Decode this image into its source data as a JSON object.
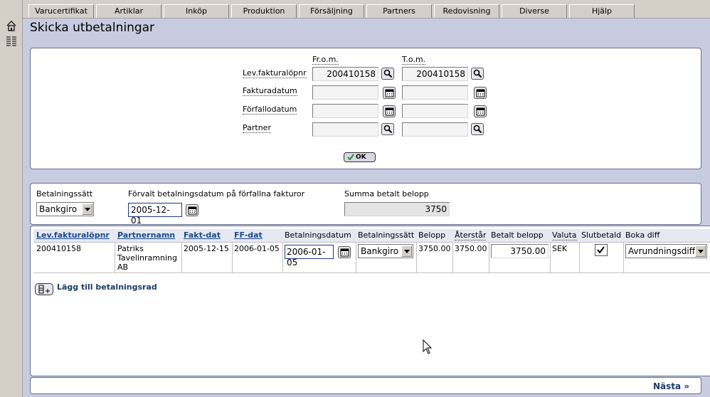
{
  "nav": {
    "tabs": [
      "Varucertifikat",
      "Artiklar",
      "Inköp",
      "Produktion",
      "Försäljning",
      "Partners",
      "Redovisning",
      "Diverse",
      "Hjälp"
    ]
  },
  "page": {
    "title": "Skicka utbetalningar"
  },
  "filter": {
    "col_from": "Fr.o.m.",
    "col_to": "T.o.m.",
    "rows": [
      {
        "label": "Lev.fakturalöpnr",
        "from": "200410158",
        "to": "200410158",
        "icon": "search-icon"
      },
      {
        "label": "Fakturadatum",
        "from": "",
        "to": "",
        "icon": "calendar-icon"
      },
      {
        "label": "Förfallodatum",
        "from": "",
        "to": "",
        "icon": "calendar-icon"
      },
      {
        "label": "Partner",
        "from": "",
        "to": "",
        "icon": "search-icon"
      }
    ],
    "ok_label": "OK"
  },
  "payment": {
    "method_label": "Betalningssätt",
    "method_value": "Bankgiro",
    "default_date_label": "Förvalt betalningsdatum på förfallna fakturor",
    "default_date_value": "2005-12-01",
    "sum_label": "Summa betalt belopp",
    "sum_value": "3750"
  },
  "table": {
    "headers": [
      "Lev.fakturalöpnr",
      "Partnernamn",
      "Fakt-dat",
      "FF-dat",
      "Betalningsdatum",
      "Betalningssätt",
      "Belopp",
      "Återstår",
      "Betalt belopp",
      "Valuta",
      "Slutbetald",
      "Boka diff"
    ],
    "row": {
      "invoice_no": "200410158",
      "partner_name": "Patriks Tavelinramning AB",
      "invoice_date": "2005-12-15",
      "due_date": "2006-01-05",
      "payment_date": "2006-01-05",
      "payment_method": "Bankgiro",
      "amount": "3750.00",
      "remaining": "3750.00",
      "paid_amount": "3750.00",
      "currency": "SEK",
      "final_paid": true,
      "book_diff": "Avrundningsdiff"
    },
    "add_row_label": "Lägg till betalningsrad"
  },
  "footer": {
    "next_label": "Nästa »"
  }
}
